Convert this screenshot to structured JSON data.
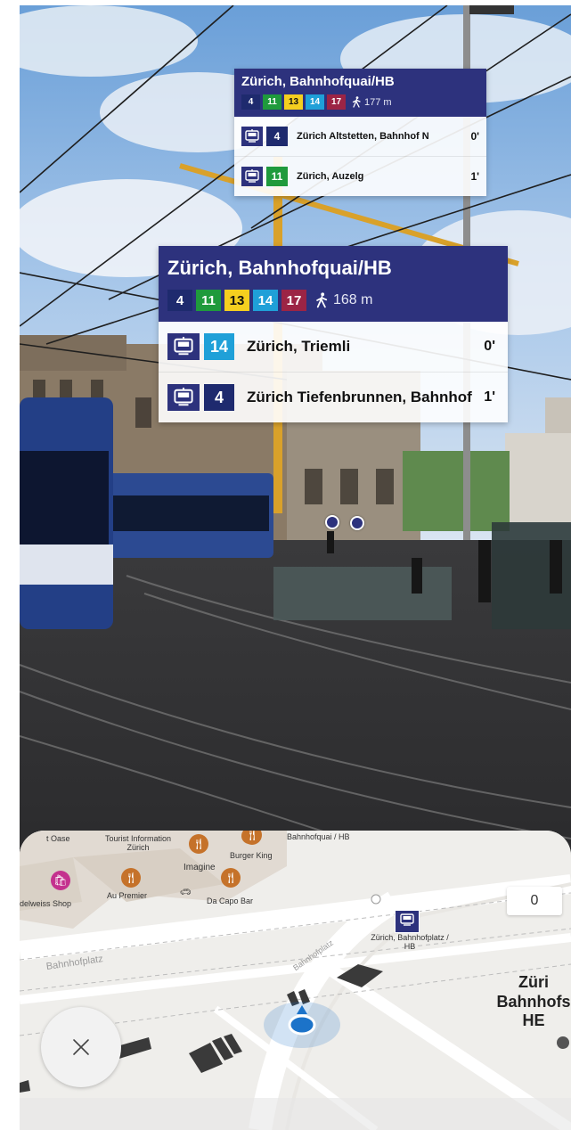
{
  "colors": {
    "sbb_blue": "#2d327d",
    "line_4": "#1e2a6e",
    "line_11": "#1f9a3c",
    "line_13": "#f5cf1f",
    "line_14": "#1fa0d8",
    "line_17": "#9c2445",
    "poi_orange": "#c5722a",
    "poi_pink": "#c4318e"
  },
  "ar_cards": {
    "far": {
      "title": "Zürich, Bahnhofquai/HB",
      "lines": [
        "4",
        "11",
        "13",
        "14",
        "17"
      ],
      "walk": "177 m",
      "departures": [
        {
          "line": "4",
          "destination": "Zürich Altstetten, Bahnhof N",
          "minutes": "0'"
        },
        {
          "line": "11",
          "destination": "Zürich, Auzelg",
          "minutes": "1'"
        }
      ]
    },
    "near": {
      "title": "Zürich, Bahnhofquai/HB",
      "lines": [
        "4",
        "11",
        "13",
        "14",
        "17"
      ],
      "walk": "168 m",
      "departures": [
        {
          "line": "14",
          "destination": "Zürich, Triemli",
          "minutes": "0'"
        },
        {
          "line": "4",
          "destination": "Zürich Tiefenbrunnen, Bahnhof",
          "minutes": "1'"
        }
      ]
    }
  },
  "map": {
    "labels": {
      "oase": "t Oase",
      "tourist_info": "Tourist Information Zürich",
      "imagine": "Imagine",
      "burger_king": "Burger King",
      "bahnhofquai_hb": "Bahnhofquai / HB",
      "au_premier": "Au Premier",
      "da_capo_bar": "Da Capo Bar",
      "edelweiss_shop": "delweiss Shop",
      "bahnhofplatz_street": "Bahnhofplatz",
      "bahnhofplatz_street_2": "Bahnhofplatz",
      "stop_label": "Zürich, Bahnhofplatz / HB",
      "station_big": "Züri\nBahnhofs\nHE",
      "zoom_value": "0"
    },
    "icons": {
      "restaurant": "fork-knife-icon",
      "shop": "shopping-bag-icon",
      "tram": "tram-icon",
      "car": "car-icon",
      "close": "close-icon",
      "location": "location-arrow-icon",
      "walk": "walking-person-icon"
    }
  }
}
